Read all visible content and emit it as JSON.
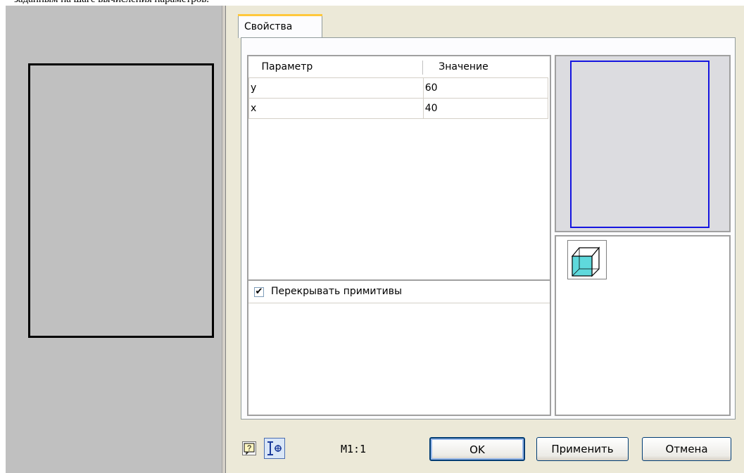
{
  "caption": "заданным на шаге вычисления параметров.",
  "dialog": {
    "tab_label": "Свойства",
    "table": {
      "headers": [
        "Параметр",
        "Значение"
      ],
      "rows": [
        {
          "param": "y",
          "value": "60"
        },
        {
          "param": "x",
          "value": "40"
        }
      ]
    },
    "overlap_checkbox": {
      "label": "Перекрывать примитивы",
      "checked": true,
      "mark": "✔"
    },
    "scale": "M1:1",
    "buttons": {
      "ok": "OK",
      "apply": "Применить",
      "cancel": "Отмена"
    }
  },
  "colors": {
    "preview_outline": "#1515e0",
    "cube_face": "#5fd9dc",
    "tab_highlight": "#ffc83c"
  },
  "icons": [
    "help-icon",
    "snap-icon",
    "cube-icon"
  ]
}
